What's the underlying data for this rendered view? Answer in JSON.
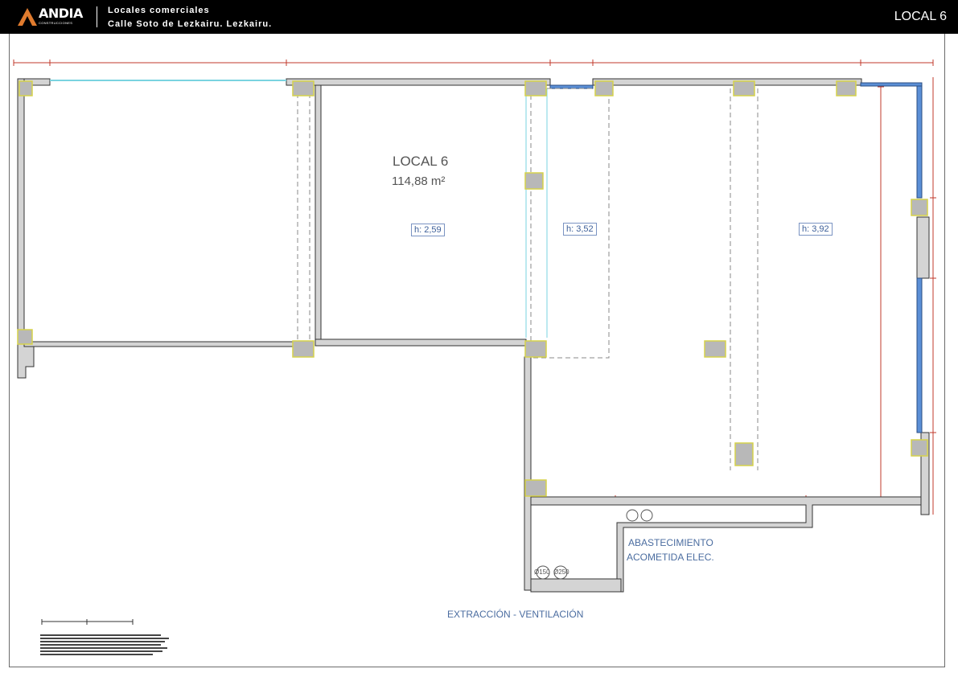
{
  "header": {
    "logo_text": "ANDIA",
    "logo_sub": "CONSTRUCCIONES",
    "project_title": "Locales comerciales",
    "project_address": "Calle Soto de Lezkairu. Lezkairu.",
    "sheet_title": "LOCAL 6"
  },
  "plan": {
    "room_name": "LOCAL 6",
    "room_area": "114,88  m²",
    "heights": [
      "h: 2,59",
      "h: 3,52",
      "h: 3,92"
    ],
    "supply_label_1": "ABASTECIMIENTO",
    "supply_label_2": "ACOMETIDA ELEC.",
    "extraction_label": "EXTRACCIÓN - VENTILACIÓN",
    "duct_1": "Ø150",
    "duct_2": "Ø250"
  },
  "colors": {
    "wall": "#d4d4d4",
    "column": "#b8b8b8",
    "column_outline": "#d6d24a",
    "glazing": "#5b8fd6",
    "dimension": "#c0392b",
    "label_blue": "#4b6da0"
  }
}
